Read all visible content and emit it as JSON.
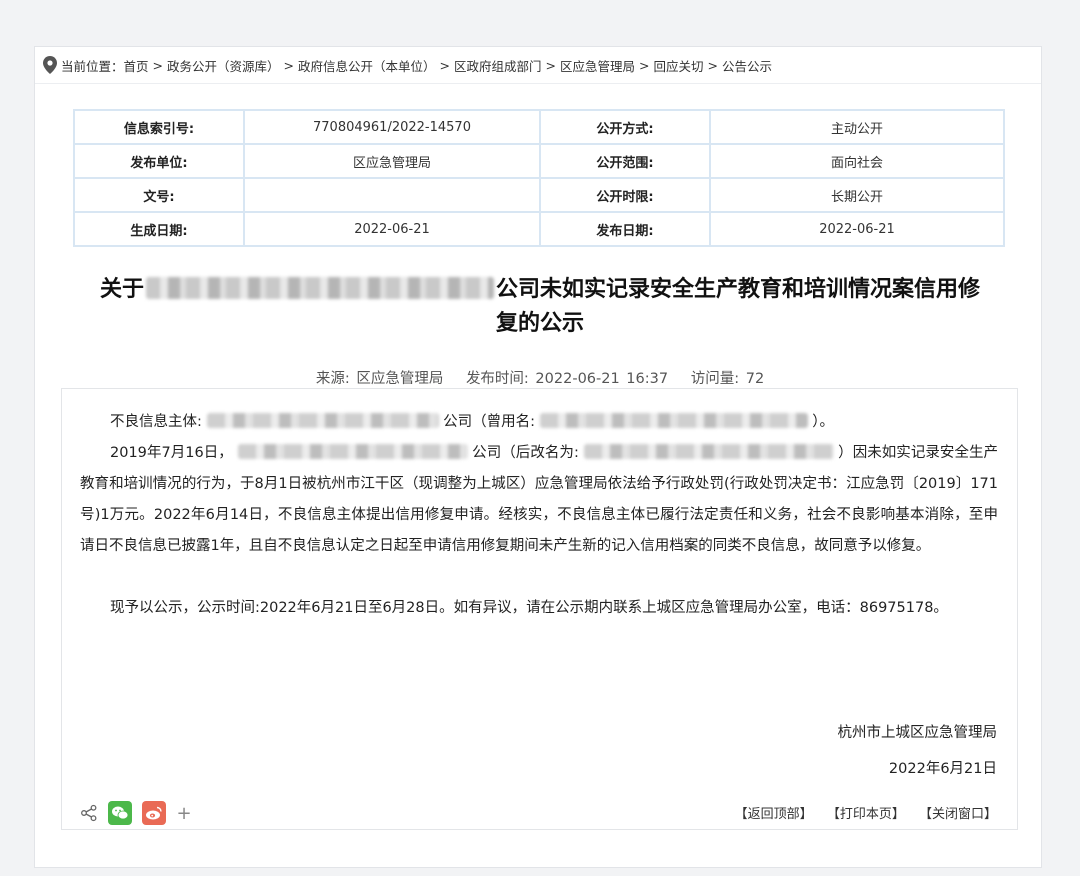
{
  "breadcrumb": {
    "label": "当前位置：",
    "items": [
      "首页",
      "政务公开（资源库）",
      "政府信息公开（本单位）",
      "区政府组成部门",
      "区应急管理局",
      "回应关切",
      "公告公示"
    ]
  },
  "meta": {
    "rows": [
      {
        "k1": "信息索引号:",
        "v1": "770804961/2022-14570",
        "k2": "公开方式:",
        "v2": "主动公开"
      },
      {
        "k1": "发布单位:",
        "v1": "区应急管理局",
        "k2": "公开范围:",
        "v2": "面向社会"
      },
      {
        "k1": "文号:",
        "v1": "",
        "k2": "公开时限:",
        "v2": "长期公开"
      },
      {
        "k1": "生成日期:",
        "v1": "2022-06-21",
        "k2": "发布日期:",
        "v2": "2022-06-21"
      }
    ]
  },
  "article": {
    "title_prefix": "关于",
    "title_suffix_line1": "公司未如实记录安全生产教育和培训情况案信用修",
    "title_line2": "复的公示",
    "source": "来源: 区应急管理局",
    "publish_time": "发布时间:  2022-06-21 16:37",
    "visits": "访问量:  72",
    "p1_a": "不良信息主体:",
    "p1_b": "公司（曾用名:",
    "p1_c": "）。",
    "p2_a": "2019年7月16日，",
    "p2_b": "公司（后改名为:",
    "p2_c": "）因未如实记录安全生产教育和培训情况的行为，于8月1日被杭州市江干区（现调整为上城区）应急管理局依法给予行政处罚(行政处罚决定书：江应急罚〔2019〕171号)1万元。2022年6月14日，不良信息主体提出信用修复申请。经核实，不良信息主体已履行法定责任和义务，社会不良影响基本消除，至申请日不良信息已披露1年，且自不良信息认定之日起至申请信用修复期间未产生新的记入信用档案的同类不良信息，故同意予以修复。",
    "p3": "现予以公示，公示时间:2022年6月21日至6月28日。如有异议，请在公示期内联系上城区应急管理局办公室，电话：86975178。",
    "signer": "杭州市上城区应急管理局",
    "sign_date": "2022年6月21日"
  },
  "footer": {
    "plus": "+",
    "back_top": "【返回顶部】",
    "print": "【打印本页】",
    "close": "【关闭窗口】"
  }
}
